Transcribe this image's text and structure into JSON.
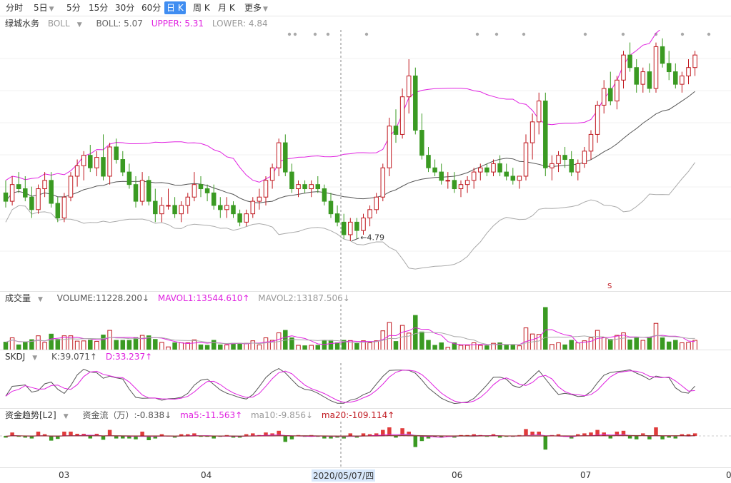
{
  "toolbar": {
    "periods": [
      {
        "label": "分时"
      },
      {
        "label": "5日",
        "chevron": true
      },
      {
        "label": "5分"
      },
      {
        "label": "15分"
      },
      {
        "label": "30分"
      },
      {
        "label": "60分"
      },
      {
        "label": "日 K",
        "active": true
      },
      {
        "label": "周 K"
      },
      {
        "label": "月 K"
      },
      {
        "label": "更多",
        "chevron": true
      }
    ]
  },
  "main_info": {
    "stock_name": "绿城水务",
    "indicator": "BOLL",
    "boll_label": "BOLL: 5.07",
    "upper_label": "UPPER: 5.31",
    "lower_label": "LOWER: 4.84"
  },
  "volume_info": {
    "name": "成交量",
    "volume_label": "VOLUME:11228.200↓",
    "mavol1_label": "MAVOL1:13544.610↑",
    "mavol2_label": "MAVOL2:13187.506↓"
  },
  "skdj_info": {
    "name": "SKDJ",
    "k_label": "K:39.071↑",
    "d_label": "D:33.237↑"
  },
  "fund_info": {
    "name": "资金趋势[L2]",
    "flow_label": "资金流（万）:-0.838↓",
    "ma5_label": "ma5:-11.563↑",
    "ma10_label": "ma10:-9.856↓",
    "ma20_label": "ma20:-109.114↑"
  },
  "x_axis": {
    "ticks": [
      "03",
      "04",
      "2020/05/07/四",
      "06",
      "07",
      "0"
    ],
    "highlight": "2020/05/07/四"
  },
  "colors": {
    "up": "#c0181f",
    "down": "#3a9a22",
    "upper_line": "#e021e0",
    "mid_line": "#555555",
    "lower_line": "#aaaaaa",
    "active_tab": "#3f8df1"
  },
  "chart_data": [
    {
      "type": "candlestick",
      "title": "绿城水务 BOLL",
      "min_annotation": "4.79",
      "marker": "S",
      "candles": [
        [
          5.02,
          5.08,
          4.95,
          4.98
        ],
        [
          4.98,
          5.1,
          4.96,
          5.06
        ],
        [
          5.06,
          5.12,
          5.02,
          5.04
        ],
        [
          5.04,
          5.1,
          4.98,
          5.0
        ],
        [
          5.0,
          5.05,
          4.9,
          4.94
        ],
        [
          4.94,
          5.06,
          4.92,
          5.04
        ],
        [
          5.04,
          5.12,
          5.0,
          5.08
        ],
        [
          5.08,
          5.12,
          4.95,
          4.97
        ],
        [
          4.97,
          5.0,
          4.88,
          4.9
        ],
        [
          4.9,
          5.02,
          4.88,
          5.0
        ],
        [
          5.0,
          5.12,
          4.98,
          5.1
        ],
        [
          5.1,
          5.18,
          5.05,
          5.15
        ],
        [
          5.15,
          5.22,
          5.08,
          5.2
        ],
        [
          5.2,
          5.25,
          5.12,
          5.14
        ],
        [
          5.14,
          5.22,
          5.1,
          5.19
        ],
        [
          5.19,
          5.3,
          5.08,
          5.1
        ],
        [
          5.1,
          5.26,
          5.06,
          5.24
        ],
        [
          5.24,
          5.28,
          5.16,
          5.18
        ],
        [
          5.18,
          5.22,
          5.1,
          5.12
        ],
        [
          5.12,
          5.16,
          5.04,
          5.06
        ],
        [
          5.06,
          5.1,
          4.95,
          4.98
        ],
        [
          4.98,
          5.12,
          4.96,
          5.08
        ],
        [
          5.08,
          5.1,
          4.96,
          4.98
        ],
        [
          4.98,
          5.04,
          4.88,
          4.92
        ],
        [
          4.92,
          5.0,
          4.88,
          4.96
        ],
        [
          4.96,
          5.04,
          4.94,
          4.96
        ],
        [
          4.96,
          5.0,
          4.9,
          4.92
        ],
        [
          4.92,
          4.98,
          4.88,
          4.96
        ],
        [
          4.96,
          5.02,
          4.92,
          5.0
        ],
        [
          5.0,
          5.12,
          4.98,
          5.06
        ],
        [
          5.06,
          5.1,
          5.0,
          5.04
        ],
        [
          5.04,
          5.06,
          4.98,
          5.02
        ],
        [
          5.02,
          5.06,
          4.94,
          4.96
        ],
        [
          4.96,
          5.0,
          4.9,
          4.94
        ],
        [
          4.94,
          5.0,
          4.9,
          4.96
        ],
        [
          4.96,
          4.98,
          4.9,
          4.92
        ],
        [
          4.92,
          4.94,
          4.86,
          4.88
        ],
        [
          4.88,
          4.94,
          4.86,
          4.92
        ],
        [
          4.92,
          5.0,
          4.9,
          4.98
        ],
        [
          4.98,
          5.04,
          4.94,
          5.0
        ],
        [
          5.0,
          5.1,
          4.96,
          5.08
        ],
        [
          5.08,
          5.16,
          5.04,
          5.14
        ],
        [
          5.14,
          5.28,
          5.1,
          5.26
        ],
        [
          5.26,
          5.3,
          5.1,
          5.12
        ],
        [
          5.12,
          5.16,
          5.02,
          5.04
        ],
        [
          5.04,
          5.08,
          5.0,
          5.06
        ],
        [
          5.06,
          5.08,
          5.02,
          5.04
        ],
        [
          5.04,
          5.08,
          5.0,
          5.06
        ],
        [
          5.06,
          5.1,
          5.02,
          5.04
        ],
        [
          5.04,
          5.06,
          4.96,
          4.98
        ],
        [
          4.98,
          5.02,
          4.9,
          4.92
        ],
        [
          4.92,
          4.96,
          4.86,
          4.88
        ],
        [
          4.88,
          4.92,
          4.8,
          4.82
        ],
        [
          4.82,
          4.9,
          4.79,
          4.88
        ],
        [
          4.88,
          4.9,
          4.8,
          4.84
        ],
        [
          4.84,
          4.92,
          4.82,
          4.9
        ],
        [
          4.9,
          4.96,
          4.86,
          4.94
        ],
        [
          4.94,
          5.02,
          4.92,
          5.0
        ],
        [
          5.0,
          5.16,
          4.98,
          5.14
        ],
        [
          5.14,
          5.38,
          5.1,
          5.34
        ],
        [
          5.34,
          5.42,
          5.26,
          5.3
        ],
        [
          5.3,
          5.52,
          5.28,
          5.48
        ],
        [
          5.48,
          5.66,
          5.4,
          5.58
        ],
        [
          5.58,
          5.62,
          5.3,
          5.32
        ],
        [
          5.32,
          5.4,
          5.18,
          5.2
        ],
        [
          5.2,
          5.24,
          5.12,
          5.14
        ],
        [
          5.14,
          5.18,
          5.1,
          5.12
        ],
        [
          5.12,
          5.16,
          5.06,
          5.08
        ],
        [
          5.08,
          5.12,
          5.04,
          5.08
        ],
        [
          5.08,
          5.12,
          5.02,
          5.04
        ],
        [
          5.04,
          5.08,
          5.0,
          5.06
        ],
        [
          5.06,
          5.1,
          5.02,
          5.08
        ],
        [
          5.08,
          5.14,
          5.04,
          5.12
        ],
        [
          5.12,
          5.16,
          5.08,
          5.14
        ],
        [
          5.14,
          5.16,
          5.1,
          5.12
        ],
        [
          5.12,
          5.18,
          5.1,
          5.16
        ],
        [
          5.16,
          5.2,
          5.1,
          5.12
        ],
        [
          5.12,
          5.16,
          5.08,
          5.1
        ],
        [
          5.1,
          5.14,
          5.06,
          5.08
        ],
        [
          5.08,
          5.1,
          5.04,
          5.1
        ],
        [
          5.1,
          5.3,
          5.08,
          5.26
        ],
        [
          5.26,
          5.4,
          5.18,
          5.36
        ],
        [
          5.36,
          5.5,
          5.3,
          5.46
        ],
        [
          5.46,
          5.5,
          5.1,
          5.14
        ],
        [
          5.14,
          5.2,
          5.08,
          5.16
        ],
        [
          5.16,
          5.22,
          5.12,
          5.2
        ],
        [
          5.2,
          5.24,
          5.14,
          5.18
        ],
        [
          5.18,
          5.22,
          5.1,
          5.12
        ],
        [
          5.12,
          5.18,
          5.08,
          5.16
        ],
        [
          5.16,
          5.24,
          5.14,
          5.22
        ],
        [
          5.22,
          5.32,
          5.18,
          5.3
        ],
        [
          5.3,
          5.46,
          5.26,
          5.44
        ],
        [
          5.44,
          5.56,
          5.4,
          5.52
        ],
        [
          5.52,
          5.6,
          5.44,
          5.46
        ],
        [
          5.46,
          5.58,
          5.42,
          5.56
        ],
        [
          5.56,
          5.7,
          5.52,
          5.68
        ],
        [
          5.68,
          5.74,
          5.6,
          5.62
        ],
        [
          5.62,
          5.66,
          5.5,
          5.54
        ],
        [
          5.54,
          5.62,
          5.5,
          5.6
        ],
        [
          5.6,
          5.64,
          5.5,
          5.52
        ],
        [
          5.52,
          5.74,
          5.5,
          5.72
        ],
        [
          5.72,
          5.76,
          5.62,
          5.64
        ],
        [
          5.64,
          5.7,
          5.56,
          5.6
        ],
        [
          5.6,
          5.64,
          5.52,
          5.54
        ],
        [
          5.54,
          5.6,
          5.5,
          5.58
        ],
        [
          5.58,
          5.66,
          5.54,
          5.62
        ],
        [
          5.62,
          5.7,
          5.58,
          5.68
        ]
      ]
    },
    {
      "type": "bar",
      "title": "成交量",
      "series_names": [
        "VOLUME",
        "MAVOL1",
        "MAVOL2"
      ]
    },
    {
      "type": "line",
      "title": "SKDJ",
      "series_names": [
        "K",
        "D"
      ]
    },
    {
      "type": "bar",
      "title": "资金趋势[L2]",
      "series_names": [
        "资金流（万）",
        "ma5",
        "ma10",
        "ma20"
      ]
    }
  ]
}
